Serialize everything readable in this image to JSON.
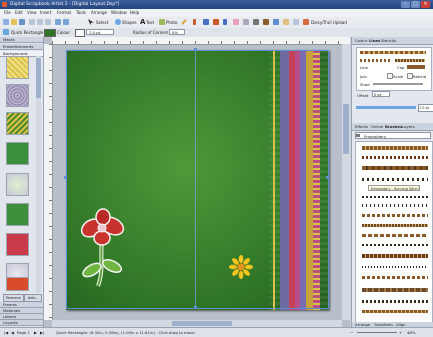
{
  "window": {
    "title": "Digital Scrapbook Artist 2 - [Digital Layout.Dsp*]",
    "minimize": "–",
    "maximize": "□",
    "close": "×"
  },
  "menu": [
    "File",
    "Edit",
    "View",
    "Insert",
    "Format",
    "Tools",
    "Arrange",
    "Window",
    "Help"
  ],
  "toolbar": {
    "select_label": "Select",
    "shapes_label": "Shapes",
    "text_label": "Text",
    "photo_label": "Photo",
    "upload_label": "Daisy/Trail Upload"
  },
  "context_toolbar": {
    "tool_name": "Quick Rectangle",
    "colour_label": "Colour",
    "line_width_value": "7.0 pt",
    "radius_label": "Radius of Corners",
    "radius_value": "0%"
  },
  "left_panel": {
    "tabs": [
      "Masks",
      "Embellishments",
      "Backgrounds"
    ],
    "bottom_tabs": [
      "Frames",
      "Materials",
      "Letters",
      "Layouts"
    ],
    "buttons": [
      "Remove",
      "Add..."
    ],
    "thumbnail_colors": [
      "#d9c244",
      "#8b7fa8",
      "#4f8a2e",
      "#3b8f3a",
      "#c93a4a",
      "#c7c8d6",
      "#d94c2a"
    ]
  },
  "right_panel": {
    "top_tabs": [
      "Colour",
      "Lines",
      "Stencils"
    ],
    "line_label": "Line",
    "cap_label": "Cap",
    "join_label": "Join",
    "scale_label": "Scale",
    "behind_label": "Behind",
    "shad_label": "Shad",
    "offset_label": "Offset",
    "offset_value": "0 pt",
    "width_value": "7.0 pt",
    "mid_tabs": [
      "Effects",
      "Online",
      "Brushes",
      "Layers"
    ],
    "category": "Embroidery",
    "tooltip": "Embroidery - Running Stitch",
    "bottom_tabs": [
      "Arrange",
      "Transform",
      "Align"
    ]
  },
  "status": {
    "page": "Page 1",
    "info": "Quick Rectangle: (6.32in, 0.36in), (1.00in x 11.61in) - Click-drag to move.",
    "zoom": "48%"
  },
  "canvas": {
    "page_color": "#2e7426",
    "ribbon_colors": [
      "#6e6aa0",
      "#c4415a",
      "#b94f86",
      "#7a6cb3",
      "#c9a33a"
    ]
  }
}
